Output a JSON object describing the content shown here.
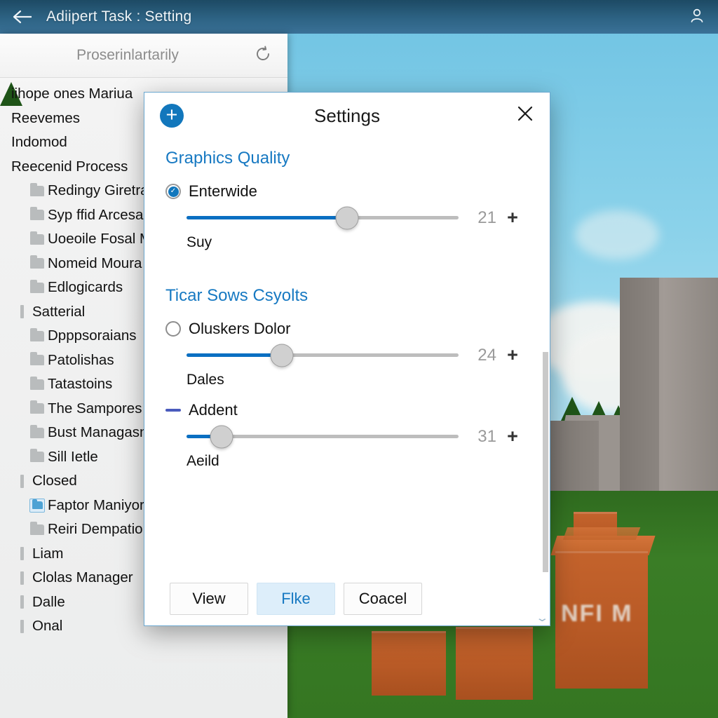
{
  "topbar": {
    "back_icon": "arrow-left-icon",
    "title": "Adiipert Task : Setting",
    "account_icon": "account-person-icon"
  },
  "explorer": {
    "search_placeholder": "Proserinlartarily",
    "refresh_icon": "refresh-icon",
    "items": [
      {
        "label": "iihope ones Mariua",
        "icon": "none",
        "level": 0
      },
      {
        "label": "Reevemes",
        "icon": "none",
        "level": 0
      },
      {
        "label": "Indomod",
        "icon": "none",
        "level": 0
      },
      {
        "label": "Reecenid Process",
        "icon": "none",
        "level": 0
      },
      {
        "label": "Redingy Giretrac",
        "icon": "folder-icon",
        "level": 1
      },
      {
        "label": "Syp ffid Arcesan",
        "icon": "folder-icon",
        "level": 1
      },
      {
        "label": "Uoeoile Fosal Ma",
        "icon": "folder-icon",
        "level": 1
      },
      {
        "label": "Nomeid Moura s",
        "icon": "folder-icon",
        "level": 1
      },
      {
        "label": "Edlogicards",
        "icon": "folder-icon",
        "level": 1
      },
      {
        "label": "Satterial",
        "icon": "bar-icon",
        "level": 0
      },
      {
        "label": "Dpppsoraians",
        "icon": "folder-icon",
        "level": 1
      },
      {
        "label": "Patolishas",
        "icon": "folder-icon",
        "level": 1
      },
      {
        "label": "Tatastoins",
        "icon": "folder-icon",
        "level": 1
      },
      {
        "label": "The Sampores",
        "icon": "folder-icon",
        "level": 1
      },
      {
        "label": "Bust Managasns",
        "icon": "folder-icon",
        "level": 1
      },
      {
        "label": "Sill Ietle",
        "icon": "folder-icon",
        "level": 1
      },
      {
        "label": "Closed",
        "icon": "bar-icon",
        "level": 0
      },
      {
        "label": "Faptor Maniyorica",
        "icon": "folder-selected-icon",
        "level": 1
      },
      {
        "label": "Reiri Dempation",
        "icon": "folder-icon",
        "level": 1
      },
      {
        "label": "Liam",
        "icon": "bar-icon",
        "level": 0
      },
      {
        "label": "Clolas Manager",
        "icon": "bar-icon",
        "level": 0
      },
      {
        "label": "Dalle",
        "icon": "bar-icon",
        "level": 0
      },
      {
        "label": "Onal",
        "icon": "bar-icon",
        "level": 0
      }
    ]
  },
  "dialog": {
    "add_icon": "plus-circle-icon",
    "title": "Settings",
    "close_icon": "close-x-icon",
    "sections": [
      {
        "heading": "Graphics Quality",
        "option_label": "Enterwide",
        "option_state": "checked",
        "option_icon": "radio-checked-icon",
        "slider_value": "21",
        "slider_percent": 59,
        "plus_label": "+",
        "sub_label": "Suy"
      },
      {
        "heading": "Ticar Sows Csyolts",
        "option_label": "Oluskers Dolor",
        "option_state": "unchecked",
        "option_icon": "radio-unchecked-icon",
        "slider_value": "24",
        "slider_percent": 35,
        "plus_label": "+",
        "sub_label": "Dales"
      },
      {
        "heading": "",
        "option_label": "Addent",
        "option_state": "dash",
        "option_icon": "dash-icon",
        "slider_value": "31",
        "slider_percent": 13,
        "plus_label": "+",
        "sub_label": "Aeild"
      }
    ],
    "buttons": [
      {
        "label": "View",
        "style": "default"
      },
      {
        "label": "Flke",
        "style": "primary"
      },
      {
        "label": "Coacel",
        "style": "default"
      }
    ],
    "resize_grip_icon": "resize-grip-icon",
    "scrollbar_icon": "vertical-scrollbar"
  },
  "scene": {
    "crate_text": "NFI M",
    "accent_blue": "#1277bc",
    "section_blue": "#1779c2",
    "slider_fill": "#0a6fc2",
    "sky_color": "#8bd2ea",
    "grass_color": "#3a7d26",
    "crate_color": "#b85a26",
    "building_color": "#8e8884"
  }
}
